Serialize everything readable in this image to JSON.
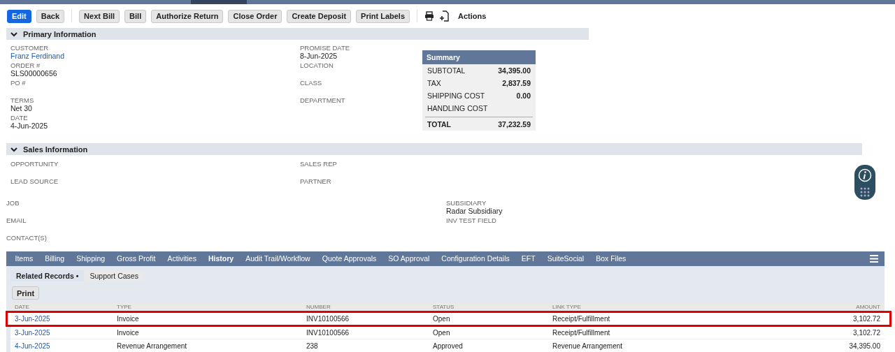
{
  "toolbar": {
    "buttons": [
      {
        "label": "Edit",
        "kind": "primary"
      },
      {
        "label": "Back",
        "kind": "plain"
      },
      {
        "label": "Next Bill",
        "kind": "plain"
      },
      {
        "label": "Bill",
        "kind": "plain"
      },
      {
        "label": "Authorize Return",
        "kind": "plain"
      },
      {
        "label": "Close Order",
        "kind": "plain"
      },
      {
        "label": "Create Deposit",
        "kind": "plain"
      },
      {
        "label": "Print Labels",
        "kind": "plain"
      }
    ],
    "actions": "Actions"
  },
  "primary": {
    "title": "Primary Information",
    "expanded": true,
    "left": [
      {
        "label": "CUSTOMER",
        "value": "Franz Ferdinand",
        "link": true
      },
      {
        "label": "ORDER #",
        "value": "SLS00000656",
        "link": false
      },
      {
        "label": "PO #"
      },
      {
        "label": "TERMS",
        "value": "Net 30",
        "link": false
      },
      {
        "label": "DATE",
        "value": "4-Jun-2025",
        "link": false
      }
    ],
    "right": [
      {
        "label": "PROMISE DATE",
        "value": "8-Jun-2025",
        "link": false
      },
      {
        "label": "LOCATION"
      },
      {
        "label": "CLASS"
      },
      {
        "label": "DEPARTMENT"
      }
    ]
  },
  "summary": {
    "title": "Summary",
    "rows": [
      {
        "label": "SUBTOTAL",
        "value": "34,395.00"
      },
      {
        "label": "TAX",
        "value": "2,837.59"
      },
      {
        "label": "SHIPPING COST",
        "value": "0.00"
      },
      {
        "label": "HANDLING COST"
      }
    ],
    "total": {
      "label": "TOTAL",
      "value": "37,232.59"
    }
  },
  "sales": {
    "title": "Sales Information",
    "expanded": true,
    "left": [
      {
        "label": "OPPORTUNITY"
      },
      {
        "label": "LEAD SOURCE"
      }
    ],
    "right": [
      {
        "label": "SALES REP"
      },
      {
        "label": "PARTNER"
      }
    ],
    "lower_left": [
      {
        "label": "JOB"
      },
      {
        "label": "EMAIL"
      },
      {
        "label": "CONTACT(S)"
      }
    ],
    "lower_right": [
      {
        "label": "SUBSIDIARY",
        "value": "Radar Subsidiary"
      },
      {
        "label": "INV TEST FIELD"
      }
    ]
  },
  "tabs": [
    {
      "label": "Items",
      "selected": false
    },
    {
      "label": "Billing",
      "selected": false
    },
    {
      "label": "Shipping",
      "selected": false
    },
    {
      "label": "Gross Profit",
      "selected": false
    },
    {
      "label": "Activities",
      "selected": false
    },
    {
      "label": "History",
      "selected": true
    },
    {
      "label": "Audit Trail/Workflow",
      "selected": false
    },
    {
      "label": "Quote Approvals",
      "selected": false
    },
    {
      "label": "SO Approval",
      "selected": false
    },
    {
      "label": "Configuration Details",
      "selected": false
    },
    {
      "label": "EFT",
      "selected": false
    },
    {
      "label": "SuiteSocial",
      "selected": false
    },
    {
      "label": "Box Files",
      "selected": false
    }
  ],
  "subtabs": [
    {
      "label": "Related Records •",
      "selected": true
    },
    {
      "label": "Support Cases",
      "selected": false
    }
  ],
  "print_button": "Print",
  "table": {
    "columns": [
      "DATE",
      "TYPE",
      "NUMBER",
      "STATUS",
      "LINK TYPE",
      "AMOUNT"
    ],
    "rows": [
      {
        "cells": [
          "3-Jun-2025",
          "Invoice",
          "INV10100566",
          "Open",
          "Receipt/Fulfillment",
          "3,102.72"
        ],
        "highlighted": true
      },
      {
        "cells": [
          "3-Jun-2025",
          "Invoice",
          "INV10100566",
          "Open",
          "Receipt/Fulfillment",
          "3,102.72"
        ],
        "highlighted": false
      },
      {
        "cells": [
          "4-Jun-2025",
          "Revenue Arrangement",
          "238",
          "Approved",
          "Revenue Arrangement",
          "34,395.00"
        ],
        "highlighted": false
      }
    ]
  }
}
